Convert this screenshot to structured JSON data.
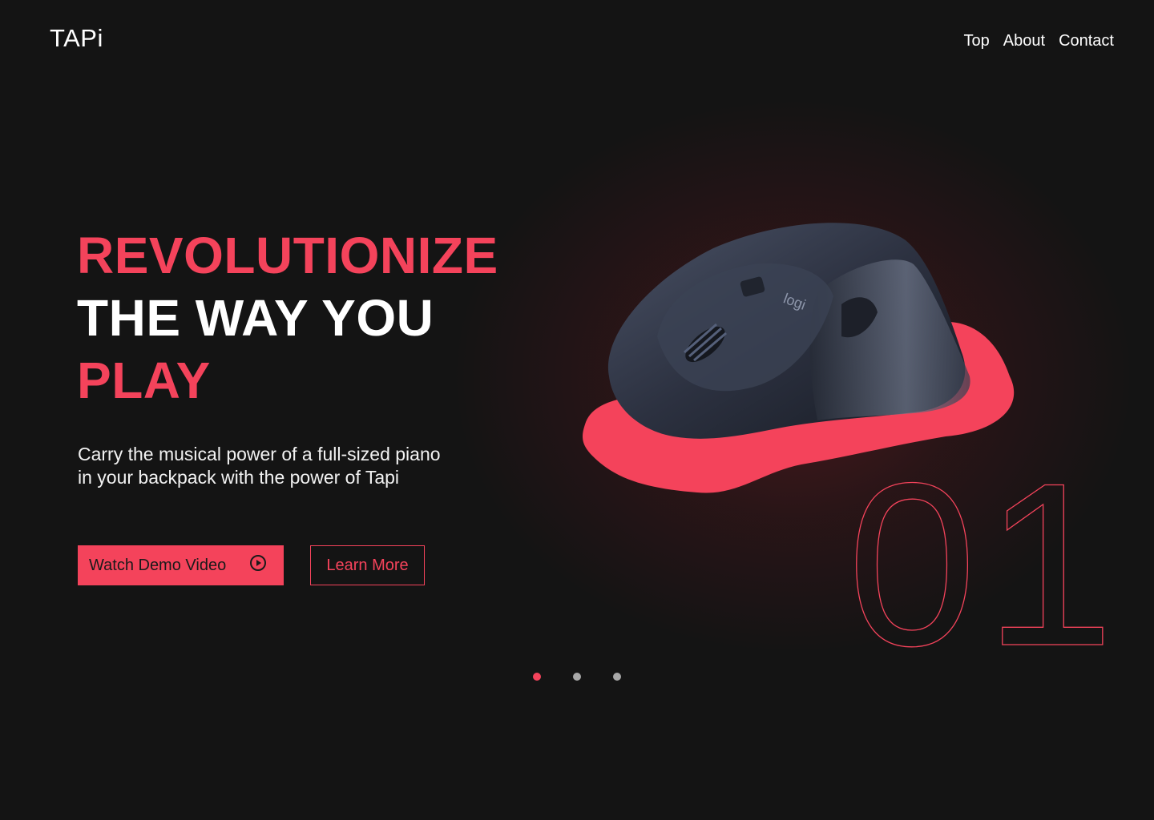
{
  "header": {
    "logo_text": "TAPi",
    "nav": [
      {
        "label": "Top"
      },
      {
        "label": "About"
      },
      {
        "label": "Contact"
      }
    ]
  },
  "hero": {
    "headline_line1": "REVOLUTIONIZE",
    "headline_line2": "THE WAY YOU",
    "headline_line3": "PLAY",
    "subtitle": "Carry the musical power of a full-sized piano in your backpack with the power of Tapi",
    "primary_button_label": "Watch Demo Video",
    "primary_button_icon": "play-circle-icon",
    "secondary_button_label": "Learn More",
    "product_brand_mark": "logi",
    "slide_number": "01"
  },
  "carousel": {
    "slide_count": 3,
    "active_index": 0
  },
  "colors": {
    "accent": "#f4435b",
    "background": "#141414",
    "text": "#ffffff",
    "inactive_dot": "#a8a8a8"
  }
}
